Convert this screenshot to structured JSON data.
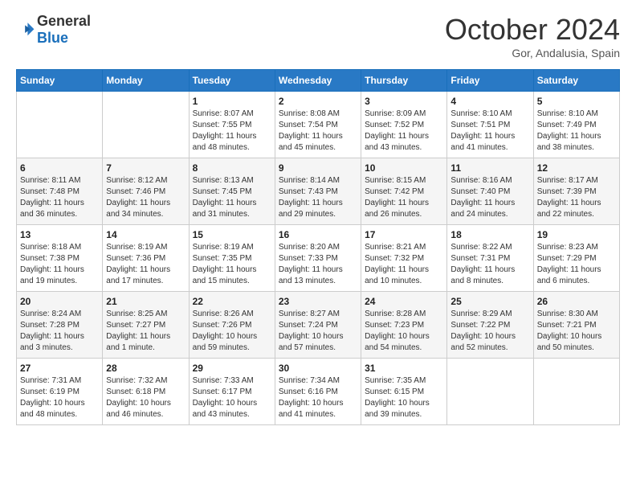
{
  "logo": {
    "text_general": "General",
    "text_blue": "Blue"
  },
  "header": {
    "month": "October 2024",
    "location": "Gor, Andalusia, Spain"
  },
  "weekdays": [
    "Sunday",
    "Monday",
    "Tuesday",
    "Wednesday",
    "Thursday",
    "Friday",
    "Saturday"
  ],
  "weeks": [
    [
      {
        "day": "",
        "sunrise": "",
        "sunset": "",
        "daylight": ""
      },
      {
        "day": "",
        "sunrise": "",
        "sunset": "",
        "daylight": ""
      },
      {
        "day": "1",
        "sunrise": "Sunrise: 8:07 AM",
        "sunset": "Sunset: 7:55 PM",
        "daylight": "Daylight: 11 hours and 48 minutes."
      },
      {
        "day": "2",
        "sunrise": "Sunrise: 8:08 AM",
        "sunset": "Sunset: 7:54 PM",
        "daylight": "Daylight: 11 hours and 45 minutes."
      },
      {
        "day": "3",
        "sunrise": "Sunrise: 8:09 AM",
        "sunset": "Sunset: 7:52 PM",
        "daylight": "Daylight: 11 hours and 43 minutes."
      },
      {
        "day": "4",
        "sunrise": "Sunrise: 8:10 AM",
        "sunset": "Sunset: 7:51 PM",
        "daylight": "Daylight: 11 hours and 41 minutes."
      },
      {
        "day": "5",
        "sunrise": "Sunrise: 8:10 AM",
        "sunset": "Sunset: 7:49 PM",
        "daylight": "Daylight: 11 hours and 38 minutes."
      }
    ],
    [
      {
        "day": "6",
        "sunrise": "Sunrise: 8:11 AM",
        "sunset": "Sunset: 7:48 PM",
        "daylight": "Daylight: 11 hours and 36 minutes."
      },
      {
        "day": "7",
        "sunrise": "Sunrise: 8:12 AM",
        "sunset": "Sunset: 7:46 PM",
        "daylight": "Daylight: 11 hours and 34 minutes."
      },
      {
        "day": "8",
        "sunrise": "Sunrise: 8:13 AM",
        "sunset": "Sunset: 7:45 PM",
        "daylight": "Daylight: 11 hours and 31 minutes."
      },
      {
        "day": "9",
        "sunrise": "Sunrise: 8:14 AM",
        "sunset": "Sunset: 7:43 PM",
        "daylight": "Daylight: 11 hours and 29 minutes."
      },
      {
        "day": "10",
        "sunrise": "Sunrise: 8:15 AM",
        "sunset": "Sunset: 7:42 PM",
        "daylight": "Daylight: 11 hours and 26 minutes."
      },
      {
        "day": "11",
        "sunrise": "Sunrise: 8:16 AM",
        "sunset": "Sunset: 7:40 PM",
        "daylight": "Daylight: 11 hours and 24 minutes."
      },
      {
        "day": "12",
        "sunrise": "Sunrise: 8:17 AM",
        "sunset": "Sunset: 7:39 PM",
        "daylight": "Daylight: 11 hours and 22 minutes."
      }
    ],
    [
      {
        "day": "13",
        "sunrise": "Sunrise: 8:18 AM",
        "sunset": "Sunset: 7:38 PM",
        "daylight": "Daylight: 11 hours and 19 minutes."
      },
      {
        "day": "14",
        "sunrise": "Sunrise: 8:19 AM",
        "sunset": "Sunset: 7:36 PM",
        "daylight": "Daylight: 11 hours and 17 minutes."
      },
      {
        "day": "15",
        "sunrise": "Sunrise: 8:19 AM",
        "sunset": "Sunset: 7:35 PM",
        "daylight": "Daylight: 11 hours and 15 minutes."
      },
      {
        "day": "16",
        "sunrise": "Sunrise: 8:20 AM",
        "sunset": "Sunset: 7:33 PM",
        "daylight": "Daylight: 11 hours and 13 minutes."
      },
      {
        "day": "17",
        "sunrise": "Sunrise: 8:21 AM",
        "sunset": "Sunset: 7:32 PM",
        "daylight": "Daylight: 11 hours and 10 minutes."
      },
      {
        "day": "18",
        "sunrise": "Sunrise: 8:22 AM",
        "sunset": "Sunset: 7:31 PM",
        "daylight": "Daylight: 11 hours and 8 minutes."
      },
      {
        "day": "19",
        "sunrise": "Sunrise: 8:23 AM",
        "sunset": "Sunset: 7:29 PM",
        "daylight": "Daylight: 11 hours and 6 minutes."
      }
    ],
    [
      {
        "day": "20",
        "sunrise": "Sunrise: 8:24 AM",
        "sunset": "Sunset: 7:28 PM",
        "daylight": "Daylight: 11 hours and 3 minutes."
      },
      {
        "day": "21",
        "sunrise": "Sunrise: 8:25 AM",
        "sunset": "Sunset: 7:27 PM",
        "daylight": "Daylight: 11 hours and 1 minute."
      },
      {
        "day": "22",
        "sunrise": "Sunrise: 8:26 AM",
        "sunset": "Sunset: 7:26 PM",
        "daylight": "Daylight: 10 hours and 59 minutes."
      },
      {
        "day": "23",
        "sunrise": "Sunrise: 8:27 AM",
        "sunset": "Sunset: 7:24 PM",
        "daylight": "Daylight: 10 hours and 57 minutes."
      },
      {
        "day": "24",
        "sunrise": "Sunrise: 8:28 AM",
        "sunset": "Sunset: 7:23 PM",
        "daylight": "Daylight: 10 hours and 54 minutes."
      },
      {
        "day": "25",
        "sunrise": "Sunrise: 8:29 AM",
        "sunset": "Sunset: 7:22 PM",
        "daylight": "Daylight: 10 hours and 52 minutes."
      },
      {
        "day": "26",
        "sunrise": "Sunrise: 8:30 AM",
        "sunset": "Sunset: 7:21 PM",
        "daylight": "Daylight: 10 hours and 50 minutes."
      }
    ],
    [
      {
        "day": "27",
        "sunrise": "Sunrise: 7:31 AM",
        "sunset": "Sunset: 6:19 PM",
        "daylight": "Daylight: 10 hours and 48 minutes."
      },
      {
        "day": "28",
        "sunrise": "Sunrise: 7:32 AM",
        "sunset": "Sunset: 6:18 PM",
        "daylight": "Daylight: 10 hours and 46 minutes."
      },
      {
        "day": "29",
        "sunrise": "Sunrise: 7:33 AM",
        "sunset": "Sunset: 6:17 PM",
        "daylight": "Daylight: 10 hours and 43 minutes."
      },
      {
        "day": "30",
        "sunrise": "Sunrise: 7:34 AM",
        "sunset": "Sunset: 6:16 PM",
        "daylight": "Daylight: 10 hours and 41 minutes."
      },
      {
        "day": "31",
        "sunrise": "Sunrise: 7:35 AM",
        "sunset": "Sunset: 6:15 PM",
        "daylight": "Daylight: 10 hours and 39 minutes."
      },
      {
        "day": "",
        "sunrise": "",
        "sunset": "",
        "daylight": ""
      },
      {
        "day": "",
        "sunrise": "",
        "sunset": "",
        "daylight": ""
      }
    ]
  ]
}
